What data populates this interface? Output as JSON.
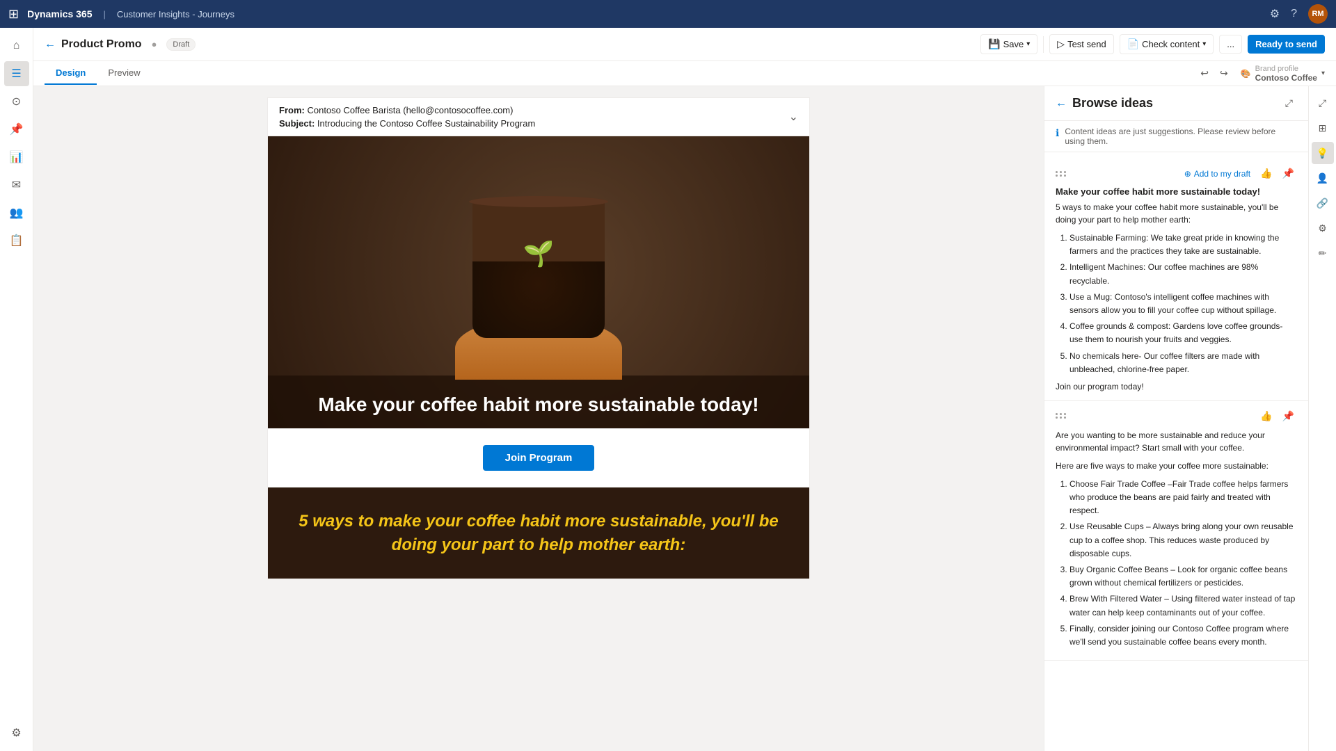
{
  "app": {
    "suite": "Dynamics 365",
    "module": "Customer Insights - Journeys"
  },
  "header": {
    "title": "Product Promo",
    "status": "Draft",
    "save_label": "Save",
    "test_send_label": "Test send",
    "check_content_label": "Check content",
    "ready_to_send_label": "Ready to send",
    "more_options": "..."
  },
  "tabs": {
    "design": "Design",
    "preview": "Preview"
  },
  "brand_profile": {
    "label": "Brand profile",
    "name": "Contoso Coffee"
  },
  "email": {
    "from_label": "From:",
    "from_value": "Contoso Coffee Barista (hello@contosocoffee.com)",
    "subject_label": "Subject:",
    "subject_value": "Introducing the Contoso Coffee Sustainability Program",
    "hero_text": "Make your coffee habit more sustainable today!",
    "cta_button": "Join Program",
    "dark_section_text": "5 ways to make your coffee habit more sustainable, you'll be doing your part to help mother earth:"
  },
  "browse_ideas": {
    "title": "Browse ideas",
    "info_text": "Content ideas are just suggestions. Please review before using them.",
    "add_to_draft": "Add to my draft",
    "idea1": {
      "headline": "Make your coffee habit more sustainable today!",
      "intro": "5 ways to make your coffee habit more sustainable, you'll be doing your part to help mother earth:",
      "points": [
        "Sustainable Farming: We take great pride in knowing the farmers and the practices they take are sustainable.",
        "Intelligent Machines: Our coffee machines are 98% recyclable.",
        "Use a Mug: Contoso's intelligent coffee machines with sensors allow you to fill your coffee cup without spillage.",
        "Coffee grounds & compost: Gardens love coffee grounds- use them to nourish your fruits and veggies.",
        "No chemicals here- Our coffee filters are made with unbleached, chlorine-free paper."
      ],
      "outro": "Join our program today!"
    },
    "idea2": {
      "intro": "Are you wanting to be more sustainable and reduce your environmental impact? Start small with your coffee.",
      "subheading": "Here are five ways to make your coffee more sustainable:",
      "points": [
        "Choose Fair Trade Coffee –Fair Trade coffee helps farmers who produce the beans are paid fairly and treated with respect.",
        "Use Reusable Cups – Always bring along your own reusable cup to a coffee shop. This reduces waste produced by disposable cups.",
        "Buy Organic Coffee Beans – Look for organic coffee beans grown without chemical fertilizers or pesticides.",
        "Brew With Filtered Water – Using filtered water instead of tap water can help keep contaminants out of your coffee.",
        "Finally, consider joining our Contoso Coffee program where we'll send you sustainable coffee beans every month."
      ]
    }
  },
  "nav": {
    "items": [
      "⊞",
      "☰",
      "◈",
      "🔔",
      "📊",
      "✉",
      "👤",
      "📋",
      "⚙",
      "❓"
    ]
  }
}
